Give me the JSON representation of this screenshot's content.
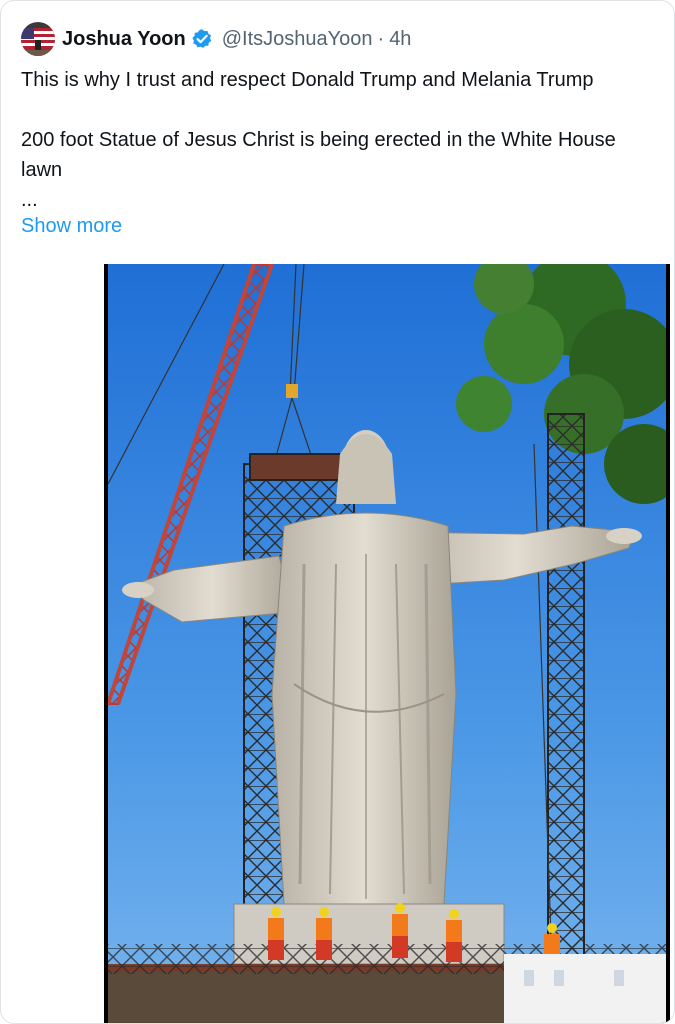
{
  "author": {
    "display_name": "Joshua Yoon",
    "handle": "@ItsJoshuaYoon",
    "separator": "·",
    "time": "4h",
    "avatar_icon": "flag-avatar",
    "verified_icon": "verified-badge-icon",
    "verified_color": "#1d9bf0"
  },
  "post": {
    "lines": [
      "This is why I trust and respect Donald Trump and Melania Trump",
      "",
      "200 foot Statue of Jesus Christ is being erected in the White House",
      "lawn",
      "..."
    ],
    "show_more": "Show more"
  },
  "media": {
    "description_icon": "statue-photo",
    "alt": "Statue with outstretched arms surrounded by cranes and scaffolding under a blue sky"
  },
  "colors": {
    "text": "#0f1419",
    "secondary": "#536471",
    "link": "#1d9bf0",
    "border": "#dfe3e6"
  }
}
